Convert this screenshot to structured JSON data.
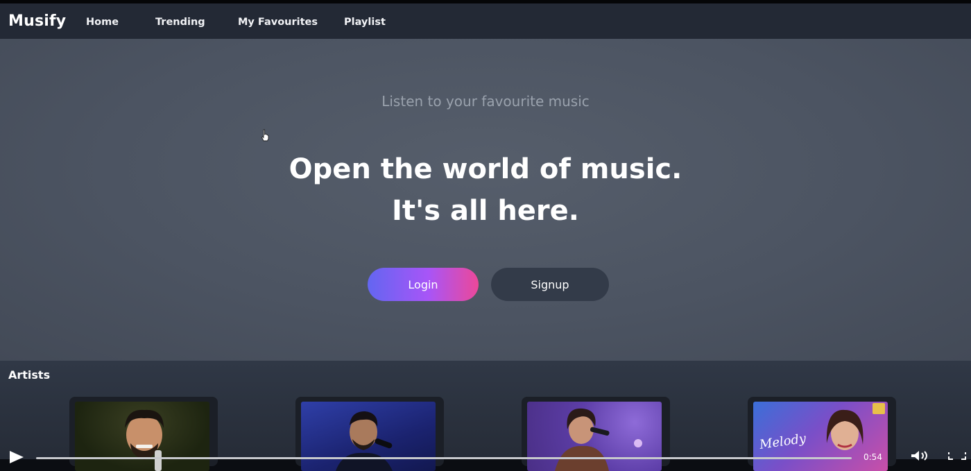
{
  "nav": {
    "brand": "Musify",
    "links": [
      "Home",
      "Trending",
      "My Favourites",
      "Playlist"
    ]
  },
  "hero": {
    "tagline": "Listen to your favourite music",
    "headline_line1": "Open the world of music.",
    "headline_line2": "It's all here.",
    "login_label": "Login",
    "signup_label": "Signup"
  },
  "artists": {
    "title": "Artists",
    "card4_caption": "Melody"
  },
  "player": {
    "time": "0:54"
  },
  "colors": {
    "nav_bg": "#232935",
    "hero_bg": "#4c5462",
    "login_gradient_start": "#6366f1",
    "login_gradient_end": "#ec4899",
    "signup_bg": "#333b49"
  }
}
